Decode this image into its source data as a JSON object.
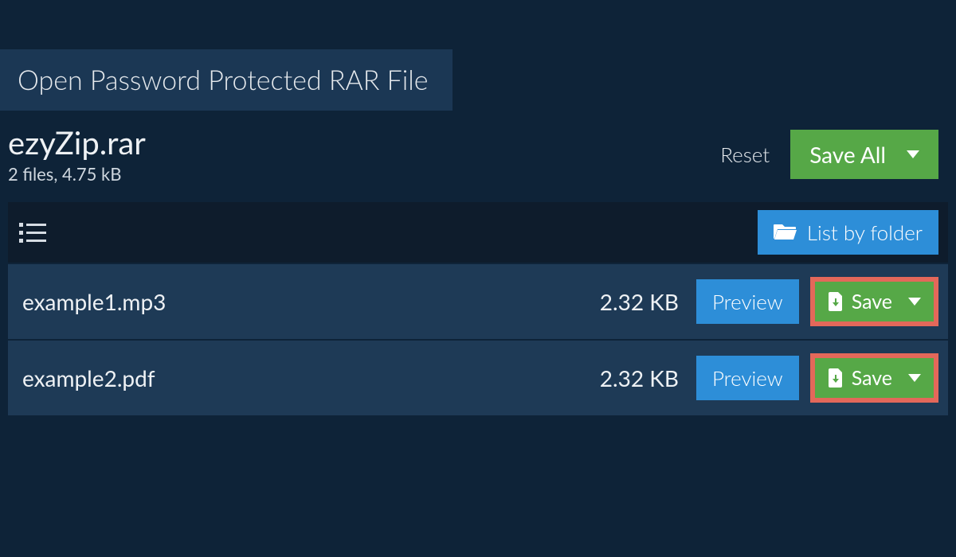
{
  "page_title": "Open Password Protected RAR File",
  "archive": {
    "name": "ezyZip.rar",
    "meta": "2 files, 4.75 kB"
  },
  "actions": {
    "reset": "Reset",
    "save_all": "Save All"
  },
  "listbar": {
    "list_by_folder": "List by folder"
  },
  "files": [
    {
      "name": "example1.mp3",
      "size": "2.32 KB",
      "preview": "Preview",
      "save": "Save"
    },
    {
      "name": "example2.pdf",
      "size": "2.32 KB",
      "preview": "Preview",
      "save": "Save"
    }
  ],
  "colors": {
    "accent_blue": "#2d8ed8",
    "accent_green": "#56a847",
    "highlight_red": "#e3685a",
    "page_bg": "#0e2338",
    "panel_bg": "#1e3a56",
    "dark_bar": "#0e1c2c",
    "tab_bg": "#1b3754"
  }
}
